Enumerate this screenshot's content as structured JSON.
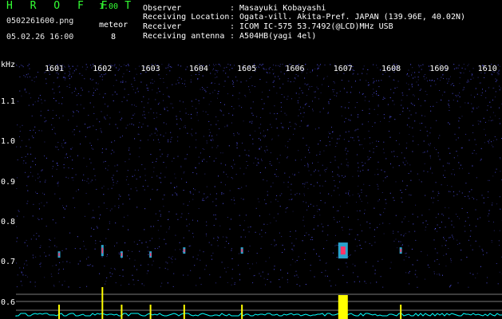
{
  "app": {
    "title": "H R O F F T",
    "version": "1.00"
  },
  "file_name": "0502261600.png",
  "datetime": "05.02.26 16:00",
  "meteor": {
    "label": "meteor",
    "count": "8"
  },
  "meta": [
    {
      "key": "Observer",
      "value": ": Masayuki Kobayashi"
    },
    {
      "key": "Receiving Location",
      "value": ": Ogata-vill. Akita-Pref. JAPAN (139.96E, 40.02N)"
    },
    {
      "key": "Receiver",
      "value": ": ICOM IC-575 53.7492(@LCD)MHz USB"
    },
    {
      "key": "Receiving antenna",
      "value": ": A504HB(yagi 4el)"
    }
  ],
  "colors": {
    "title": "#33ff33",
    "background_noise": "#000066",
    "meteor_core": "#ff3366",
    "count_bars": "#ffff00",
    "baseline": "#00ffff"
  },
  "chart_data": {
    "type": "heatmap",
    "x_label": "",
    "x_ticks": [
      "1601",
      "1602",
      "1603",
      "1604",
      "1605",
      "1606",
      "1607",
      "1608",
      "1609",
      "1610"
    ],
    "y_unit": "kHz",
    "y_ticks": [
      "1.1",
      "1.0",
      "0.9",
      "0.8",
      "0.7",
      "0.6"
    ],
    "ylim": [
      0.6,
      1.2
    ],
    "meteor_echoes": [
      {
        "minute": 1601.1,
        "freq_khz": 0.72,
        "strength": "weak"
      },
      {
        "minute": 1602.0,
        "freq_khz": 0.73,
        "strength": "medium"
      },
      {
        "minute": 1602.4,
        "freq_khz": 0.72,
        "strength": "weak"
      },
      {
        "minute": 1603.0,
        "freq_khz": 0.72,
        "strength": "weak"
      },
      {
        "minute": 1603.7,
        "freq_khz": 0.73,
        "strength": "weak"
      },
      {
        "minute": 1604.9,
        "freq_khz": 0.73,
        "strength": "weak"
      },
      {
        "minute": 1607.0,
        "freq_khz": 0.73,
        "strength": "strong"
      },
      {
        "minute": 1608.2,
        "freq_khz": 0.73,
        "strength": "weak"
      }
    ]
  }
}
